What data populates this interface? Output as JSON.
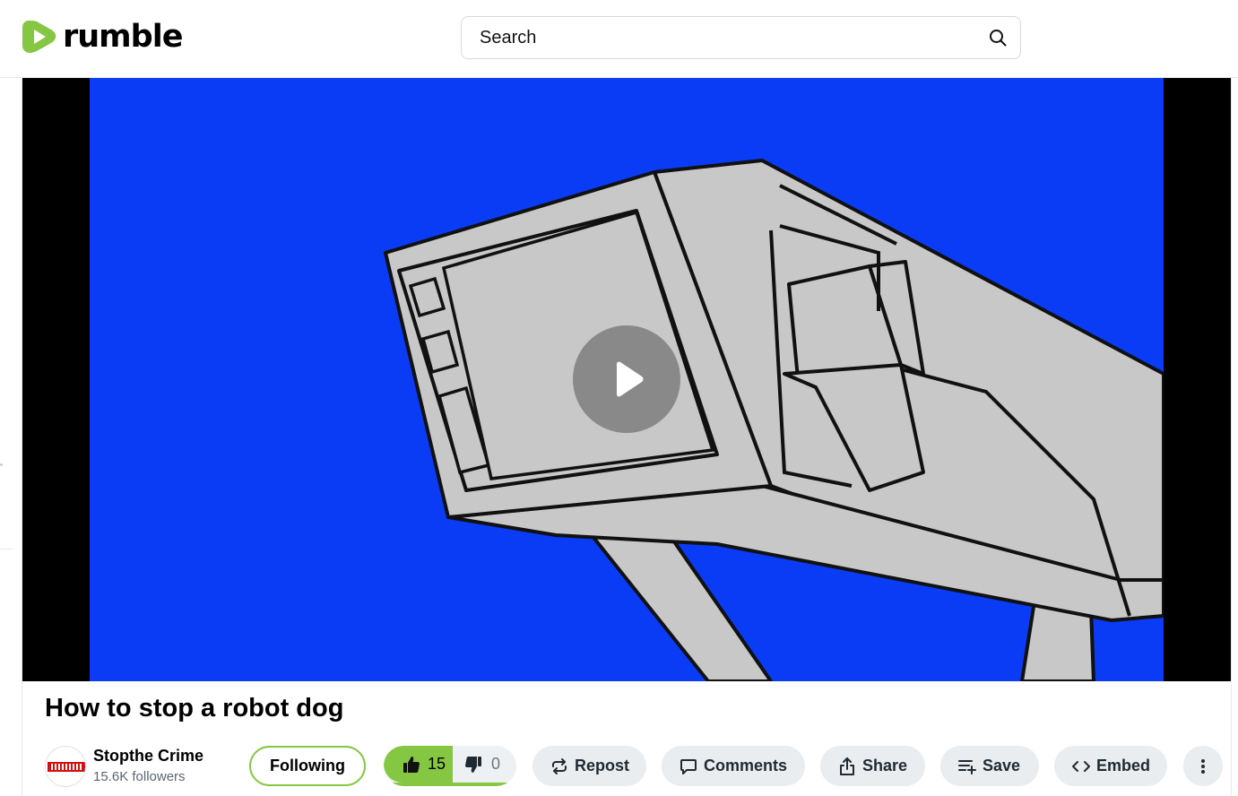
{
  "brand": {
    "name": "rumble",
    "accent": "#85c742"
  },
  "search": {
    "placeholder": "Search",
    "icon": "search-icon"
  },
  "video": {
    "title": "How to stop a robot dog",
    "play_icon": "play-icon",
    "frame_background": "#0a3cf5"
  },
  "channel": {
    "name": "Stopthe Crime",
    "followers": "15.6K followers",
    "follow_label": "Following"
  },
  "votes": {
    "up_count": "15",
    "down_count": "0",
    "like_ratio": 1.0
  },
  "actions": {
    "repost": "Repost",
    "comments": "Comments",
    "share": "Share",
    "save": "Save",
    "embed": "Embed"
  }
}
